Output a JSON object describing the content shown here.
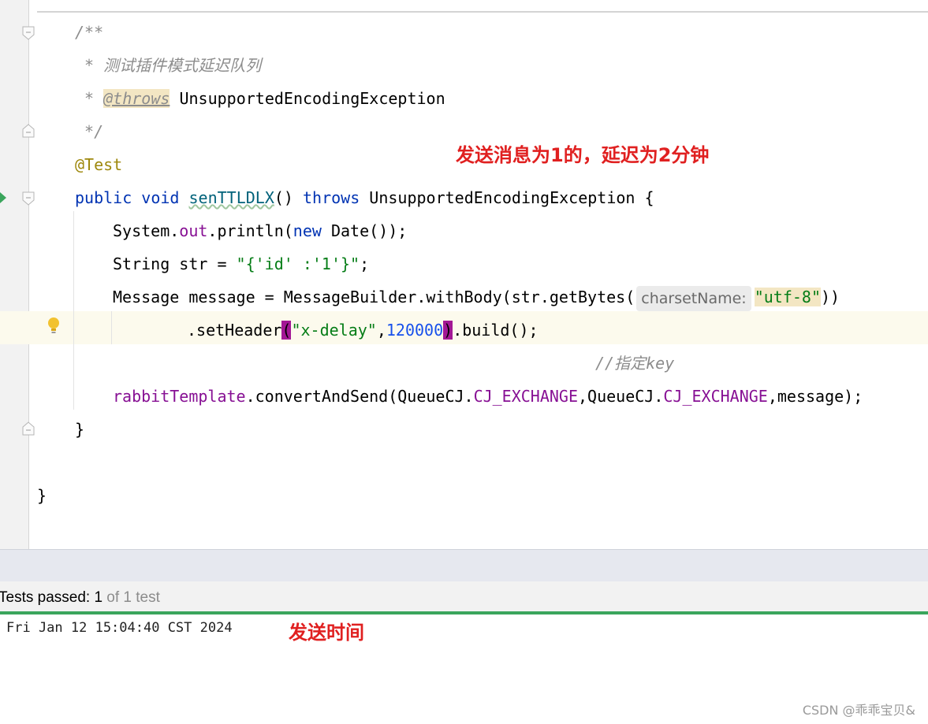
{
  "editor": {
    "code": {
      "doc_open": "/**",
      "doc_desc": " * 测试插件模式延迟队列",
      "doc_throws_prefix": " * ",
      "doc_throws_tag": "@throws",
      "doc_throws_type": " UnsupportedEncodingException",
      "doc_close": " */",
      "annotation": "@Test",
      "sig_public": "public",
      "sig_void": "void",
      "sig_name": "senTTLDLX",
      "sig_parens": "() ",
      "sig_throws": "throws",
      "sig_rest": " UnsupportedEncodingException {",
      "l1_a": "System.",
      "l1_out": "out",
      "l1_b": ".println(",
      "l1_new": "new",
      "l1_c": " Date());",
      "l2_a": "String str = ",
      "l2_str": "\"{'id' :'1'}\"",
      "l2_b": ";",
      "l3_a": "Message message = MessageBuilder.withBody(str.getBytes(",
      "l3_hint": "charsetName:",
      "l3_str": "\"utf-8\"",
      "l3_b": "))",
      "l4_a": ".setHeader",
      "l4_open": "(",
      "l4_str": "\"x-delay\"",
      "l4_comma": ",",
      "l4_num": "120000",
      "l4_close": ")",
      "l4_b": ".build();",
      "l5_comment": "//指定key",
      "l6_a": "rabbitTemplate",
      "l6_b": ".convertAndSend(QueueCJ.",
      "l6_f1": "CJ_EXCHANGE",
      "l6_c": ",QueueCJ.",
      "l6_f2": "CJ_EXCHANGE",
      "l6_d": ",message);",
      "method_close": "}",
      "class_close": "}"
    },
    "annotation_text": "发送消息为1的，延迟为2分钟"
  },
  "status": {
    "prefix": "Tests passed: ",
    "passed": "1",
    "suffix": " of 1 test"
  },
  "console": {
    "output": "Fri Jan 12 15:04:40 CST 2024",
    "annotation_text": "发送时间"
  },
  "watermark": "CSDN @乖乖宝贝&"
}
